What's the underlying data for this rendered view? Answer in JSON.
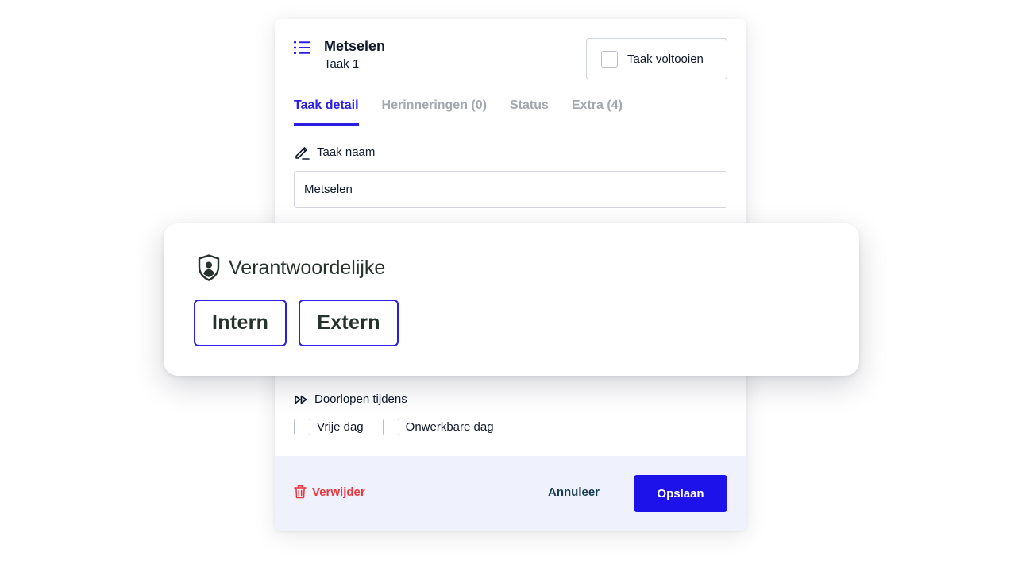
{
  "task": {
    "title": "Metselen",
    "subtitle": "Taak 1",
    "complete_label": "Taak voltooien"
  },
  "tabs": [
    {
      "label": "Taak detail",
      "active": true
    },
    {
      "label": "Herinneringen (0)",
      "active": false
    },
    {
      "label": "Status",
      "active": false
    },
    {
      "label": "Extra (4)",
      "active": false
    }
  ],
  "name_field": {
    "label": "Taak naam",
    "value": "Metselen"
  },
  "responsible": {
    "title": "Verantwoordelijke",
    "options": [
      "Intern",
      "Extern"
    ]
  },
  "continue_during": {
    "label": "Doorlopen tijdens",
    "options": [
      {
        "label": "Vrije dag",
        "checked": false
      },
      {
        "label": "Onwerkbare dag",
        "checked": false
      }
    ]
  },
  "footer": {
    "delete_label": "Verwijder",
    "cancel_label": "Annuleer",
    "save_label": "Opslaan"
  },
  "colors": {
    "accent": "#2a1fe3",
    "primary_button": "#1d12ea",
    "danger": "#e8383d",
    "footer_bg": "#eff1fd"
  },
  "icons": [
    "list-icon",
    "pencil-icon",
    "shield-user-icon",
    "fast-forward-icon",
    "trash-icon"
  ]
}
